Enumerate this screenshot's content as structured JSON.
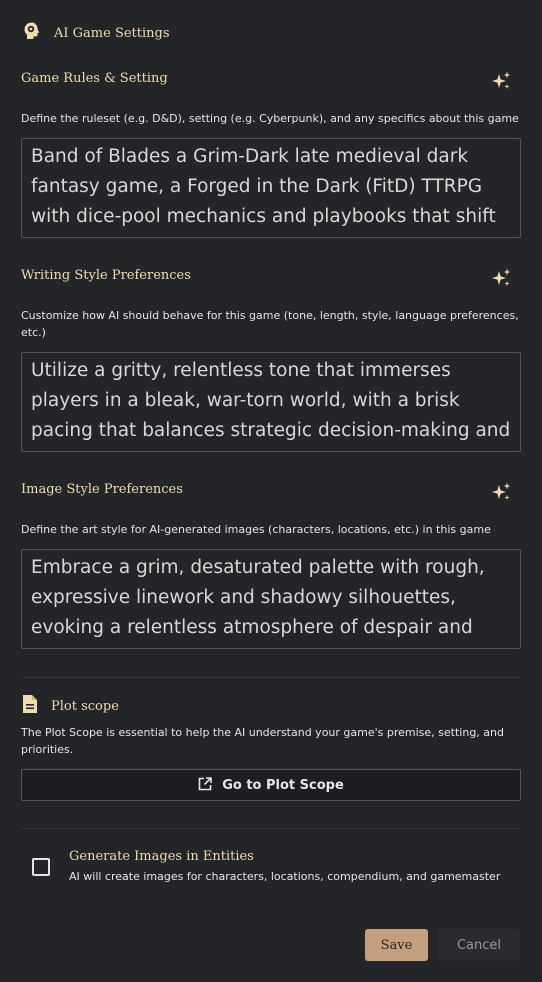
{
  "header": {
    "icon": "brain-head-icon",
    "title": "AI Game Settings"
  },
  "colors": {
    "background": "#242529",
    "accent": "#f0dcb0",
    "save_button": "#c4a080",
    "border": "#55565b"
  },
  "sections": [
    {
      "title": "Game Rules & Setting",
      "action_icon": "sparkles-icon",
      "description": "Define the ruleset (e.g. D&D), setting (e.g. Cyberpunk), and any specifics about this game",
      "value": "Band of Blades a Grim-Dark late medieval dark fantasy game, a Forged in the Dark (FitD) TTRPG with dice-pool mechanics and playbooks that shift"
    },
    {
      "title": "Writing Style Preferences",
      "action_icon": "sparkles-icon",
      "description": "Customize how AI should behave for this game (tone, length, style, language preferences, etc.)",
      "value": "Utilize a gritty, relentless tone that immerses players in a bleak, war-torn world, with a brisk pacing that balances strategic decision-making and"
    },
    {
      "title": "Image Style Preferences",
      "action_icon": "sparkles-icon",
      "description": "Define the art style for AI-generated images (characters, locations, etc.) in this game",
      "value": "Embrace a grim, desaturated palette with rough, expressive linework and shadowy silhouettes, evoking a relentless atmosphere of despair and"
    }
  ],
  "plot_scope": {
    "icon": "document-icon",
    "title": "Plot scope",
    "description": "The Plot Scope is essential to help the AI understand your game's premise, setting, and priorities.",
    "button_icon": "external-link-icon",
    "button_label": "Go to Plot Scope"
  },
  "generate_images": {
    "checked": false,
    "title": "Generate Images in Entities",
    "description": "AI will create images for characters, locations, compendium, and gamemaster"
  },
  "footer": {
    "save_label": "Save",
    "cancel_label": "Cancel"
  }
}
